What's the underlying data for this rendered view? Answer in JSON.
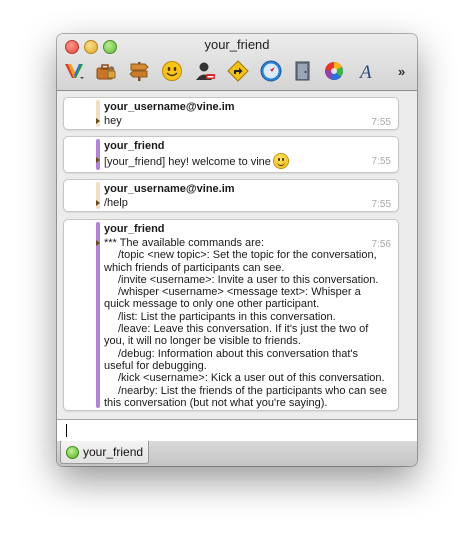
{
  "window": {
    "title": "your_friend"
  },
  "toolbar": {
    "icons": [
      "multicolor-v-icon",
      "briefcase-lock-icon",
      "signpost-icon",
      "smiley-icon",
      "block-user-icon",
      "diamond-arrow-icon",
      "safari-compass-icon",
      "door-icon",
      "color-wheel-icon",
      "font-icon"
    ],
    "overflow": "»"
  },
  "messages": [
    {
      "sender": "your_username@vine.im",
      "text": "hey",
      "time": "7:55",
      "role": "self"
    },
    {
      "sender": "your_friend",
      "text": "[your_friend] hey! welcome to vine",
      "time": "7:55",
      "role": "friend",
      "emoji": "smiley"
    },
    {
      "sender": "your_username@vine.im",
      "text": "/help",
      "time": "7:55",
      "role": "self"
    },
    {
      "sender": "your_friend",
      "time": "7:56",
      "role": "friend",
      "lines": [
        "*** The available commands are:",
        "/topic <new topic>: Set the topic for the conversation,",
        "which friends of participants can see.",
        "/invite <username>: Invite a user to this conversation.",
        "/whisper <username> <message text>: Whisper a",
        "quick message to only one other participant.",
        "/list: List the participants in this conversation.",
        "/leave: Leave this conversation. If it's just the two of",
        "you, it will no longer be visible to friends.",
        "/debug: Information about this conversation that's",
        "useful for debugging.",
        "/kick <username>: Kick a user out of this conversation.",
        "/nearby: List the friends of the participants who can see",
        "this conversation (but not what you're saying)."
      ]
    }
  ],
  "input": {
    "value": ""
  },
  "tabs": [
    {
      "label": "your_friend",
      "status": "online"
    }
  ],
  "colors": {
    "self_bar": "#f0dfc2",
    "friend_bar": "#b084d6",
    "status_online": "#4fae22"
  }
}
